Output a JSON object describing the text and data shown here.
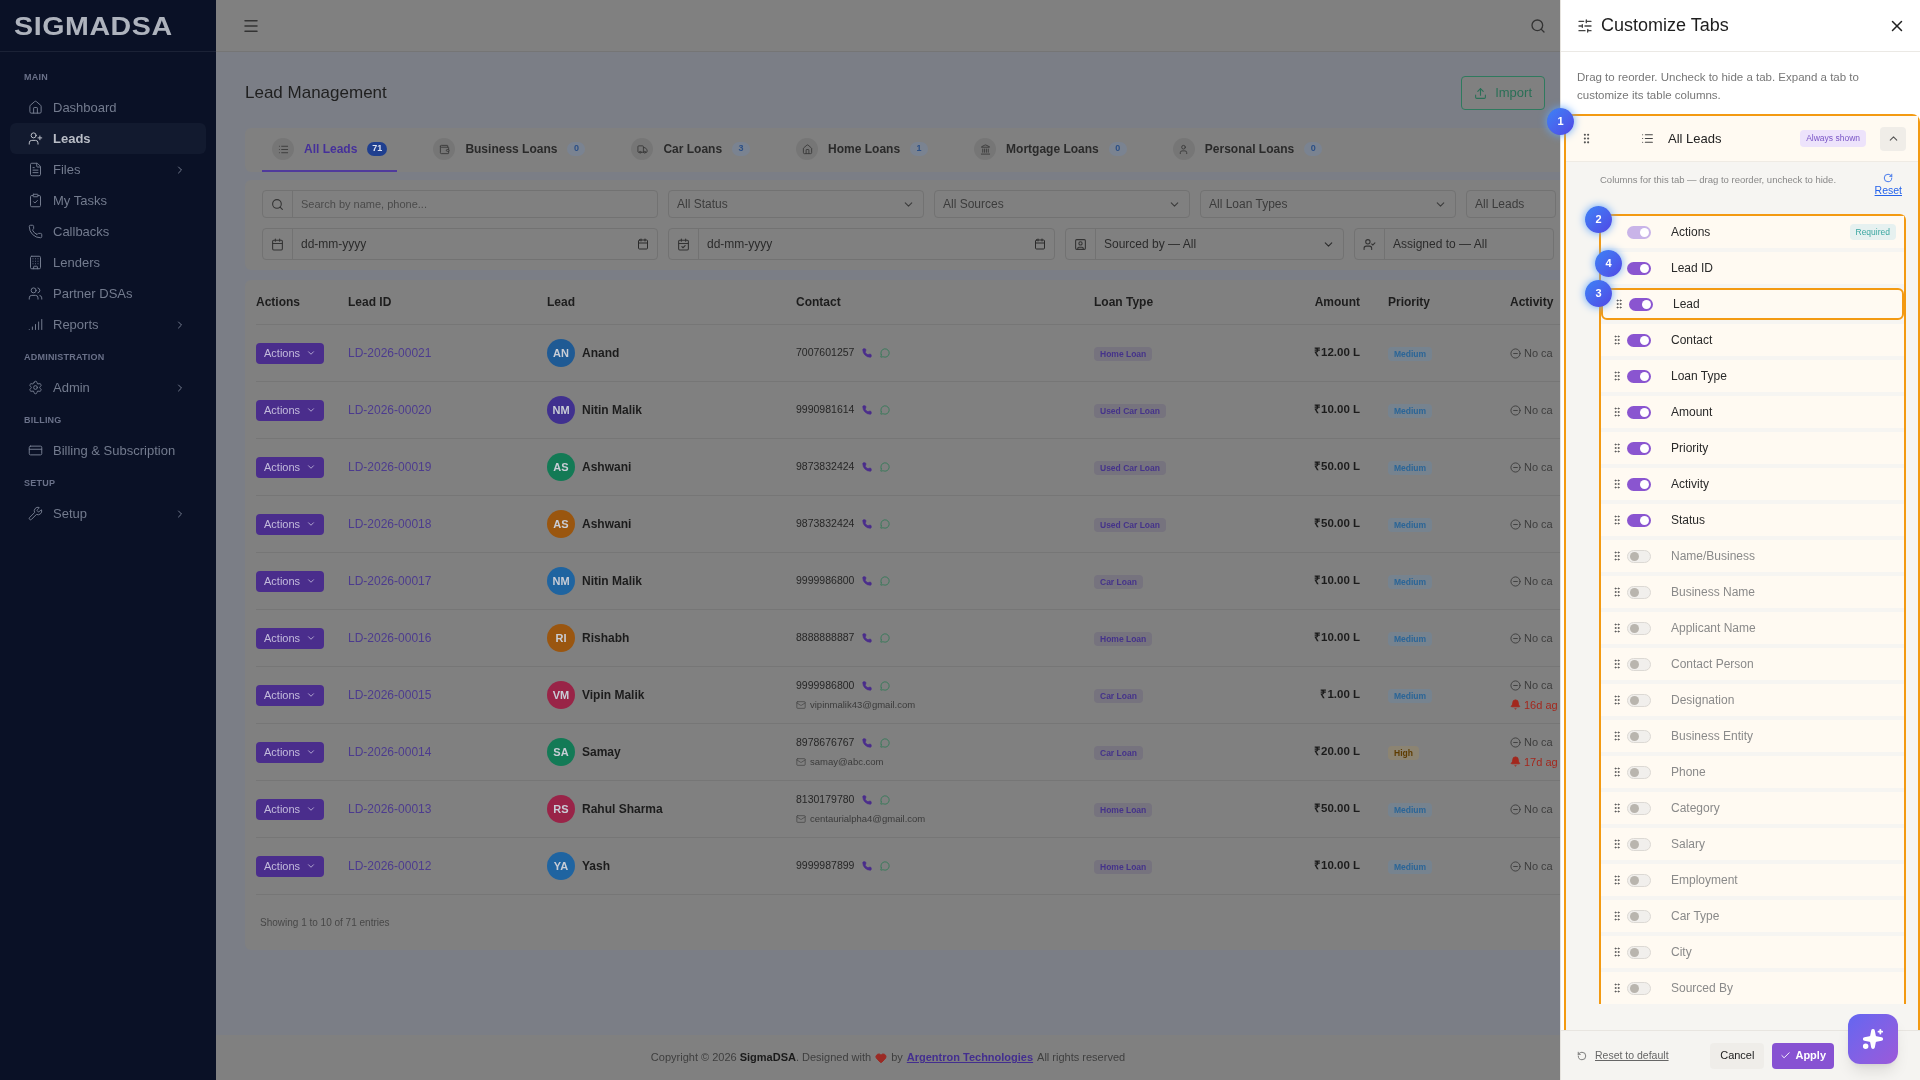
{
  "sidebar": {
    "logo": "SIGMADSA",
    "sections": [
      {
        "title": "MAIN",
        "items": [
          {
            "label": "Dashboard",
            "selected": false,
            "expandable": false
          },
          {
            "label": "Leads",
            "selected": true,
            "expandable": false
          },
          {
            "label": "Files",
            "selected": false,
            "expandable": true
          },
          {
            "label": "My Tasks",
            "selected": false,
            "expandable": false
          },
          {
            "label": "Callbacks",
            "selected": false,
            "expandable": false
          },
          {
            "label": "Lenders",
            "selected": false,
            "expandable": false
          },
          {
            "label": "Partner DSAs",
            "selected": false,
            "expandable": false
          },
          {
            "label": "Reports",
            "selected": false,
            "expandable": true
          }
        ]
      },
      {
        "title": "ADMINISTRATION",
        "items": [
          {
            "label": "Admin",
            "selected": false,
            "expandable": true
          }
        ]
      },
      {
        "title": "BILLING",
        "items": [
          {
            "label": "Billing & Subscription",
            "selected": false,
            "expandable": false
          }
        ]
      },
      {
        "title": "SETUP",
        "items": [
          {
            "label": "Setup",
            "selected": false,
            "expandable": true
          }
        ]
      }
    ]
  },
  "page": {
    "title": "Lead Management",
    "import_button": "Import"
  },
  "tabs": [
    {
      "label": "All Leads",
      "count": "71",
      "selected": true
    },
    {
      "label": "Business Loans",
      "count": "0",
      "selected": false
    },
    {
      "label": "Car Loans",
      "count": "3",
      "selected": false
    },
    {
      "label": "Home Loans",
      "count": "1",
      "selected": false
    },
    {
      "label": "Mortgage Loans",
      "count": "0",
      "selected": false
    },
    {
      "label": "Personal Loans",
      "count": "0",
      "selected": false
    }
  ],
  "filters": {
    "search": {
      "placeholder": "Search by name, phone..."
    },
    "selects": [
      "All Status",
      "All Sources",
      "All Loan Types",
      "All Leads"
    ],
    "date_from": {
      "placeholder": "dd-mm-yyyy"
    },
    "date_to": {
      "placeholder": "dd-mm-yyyy"
    },
    "sourced_by": "Sourced by — All",
    "assigned_to": "Assigned to — All"
  },
  "table": {
    "columns": [
      "Actions",
      "Lead ID",
      "Lead",
      "Contact",
      "Loan Type",
      "Amount",
      "Priority",
      "Activity"
    ],
    "rows": [
      {
        "action": "Actions",
        "lead_id": "LD-2026-00021",
        "initials": "AN",
        "name": "Anand",
        "color": "#1f5a94",
        "phone": "7007601257",
        "loan_type": "Home Loan",
        "amount": "₹12.00 L",
        "priority": {
          "label": "Medium",
          "kind": "medium"
        },
        "activity": "No ca"
      },
      {
        "action": "Actions",
        "lead_id": "LD-2026-00020",
        "initials": "NM",
        "name": "Nitin Malik",
        "color": "#40308f",
        "phone": "9990981614",
        "loan_type": "Used Car Loan",
        "amount": "₹10.00 L",
        "priority": {
          "label": "Medium",
          "kind": "medium"
        },
        "activity": "No ca"
      },
      {
        "action": "Actions",
        "lead_id": "LD-2026-00019",
        "initials": "AS",
        "name": "Ashwani",
        "color": "#137a55",
        "phone": "9873832424",
        "loan_type": "Used Car Loan",
        "amount": "₹50.00 L",
        "priority": {
          "label": "Medium",
          "kind": "medium"
        },
        "activity": "No ca"
      },
      {
        "action": "Actions",
        "lead_id": "LD-2026-00018",
        "initials": "AS",
        "name": "Ashwani",
        "color": "#9a560f",
        "phone": "9873832424",
        "loan_type": "Used Car Loan",
        "amount": "₹50.00 L",
        "priority": {
          "label": "Medium",
          "kind": "medium"
        },
        "activity": "No ca"
      },
      {
        "action": "Actions",
        "lead_id": "LD-2026-00017",
        "initials": "NM",
        "name": "Nitin Malik",
        "color": "#1f64a0",
        "phone": "9999986800",
        "loan_type": "Car Loan",
        "amount": "₹10.00 L",
        "priority": {
          "label": "Medium",
          "kind": "medium"
        },
        "activity": "No ca"
      },
      {
        "action": "Actions",
        "lead_id": "LD-2026-00016",
        "initials": "RI",
        "name": "Rishabh",
        "color": "#9a5610",
        "phone": "8888888887",
        "loan_type": "Home Loan",
        "amount": "₹10.00 L",
        "priority": {
          "label": "Medium",
          "kind": "medium"
        },
        "activity": "No ca"
      },
      {
        "action": "Actions",
        "lead_id": "LD-2026-00015",
        "initials": "VM",
        "name": "Vipin Malik",
        "color": "#992447",
        "phone": "9999986800",
        "email": "vipinmalik43@gmail.com",
        "loan_type": "Car Loan",
        "amount": "₹1.00 L",
        "priority": {
          "label": "Medium",
          "kind": "medium"
        },
        "activity": "No ca",
        "reminder": "16d ag"
      },
      {
        "action": "Actions",
        "lead_id": "LD-2026-00014",
        "initials": "SA",
        "name": "Samay",
        "color": "#137a56",
        "phone": "8978676767",
        "email": "samay@abc.com",
        "loan_type": "Car Loan",
        "amount": "₹20.00 L",
        "priority": {
          "label": "High",
          "kind": "high"
        },
        "activity": "No ca",
        "reminder": "17d ag"
      },
      {
        "action": "Actions",
        "lead_id": "LD-2026-00013",
        "initials": "RS",
        "name": "Rahul Sharma",
        "color": "#992448",
        "phone": "8130179780",
        "email": "centaurialpha4@gmail.com",
        "loan_type": "Home Loan",
        "amount": "₹50.00 L",
        "priority": {
          "label": "Medium",
          "kind": "medium"
        },
        "activity": "No ca"
      },
      {
        "action": "Actions",
        "lead_id": "LD-2026-00012",
        "initials": "YA",
        "name": "Yash",
        "color": "#1f64a1",
        "phone": "9999987899",
        "loan_type": "Home Loan",
        "amount": "₹10.00 L",
        "priority": {
          "label": "Medium",
          "kind": "medium"
        },
        "activity": "No ca"
      }
    ],
    "summary": "Showing 1 to 10 of 71 entries"
  },
  "footer": {
    "before": "Copyright © 2026 **SigmaDSA**. Designed with",
    "by": "by",
    "link": "Argentron Technologies",
    "after": "All rights reserved"
  },
  "panel": {
    "title": "Customize Tabs",
    "description": "Drag to reorder. Uncheck to hide a tab. Expand a tab to customize its table columns.",
    "tab": {
      "label": "All Leads",
      "badge": "Always shown",
      "expanded": true
    },
    "columns_note": "Columns for this tab — drag to reorder, uncheck to hide.",
    "reset": "Reset",
    "columns": [
      {
        "label": "Actions",
        "on": true,
        "disabled": true,
        "badge": "Required",
        "highlighted": false
      },
      {
        "label": "Lead ID",
        "on": true,
        "disabled": false,
        "highlighted": false
      },
      {
        "label": "Lead",
        "on": true,
        "disabled": false,
        "highlighted": true
      },
      {
        "label": "Contact",
        "on": true,
        "disabled": false,
        "highlighted": false
      },
      {
        "label": "Loan Type",
        "on": true,
        "disabled": false,
        "highlighted": false
      },
      {
        "label": "Amount",
        "on": true,
        "disabled": false,
        "highlighted": false
      },
      {
        "label": "Priority",
        "on": true,
        "disabled": false,
        "highlighted": false
      },
      {
        "label": "Activity",
        "on": true,
        "disabled": false,
        "highlighted": false
      },
      {
        "label": "Status",
        "on": true,
        "disabled": false,
        "highlighted": false
      },
      {
        "label": "Name/Business",
        "on": false,
        "disabled": false,
        "highlighted": false
      },
      {
        "label": "Business Name",
        "on": false,
        "disabled": false,
        "highlighted": false
      },
      {
        "label": "Applicant Name",
        "on": false,
        "disabled": false,
        "highlighted": false
      },
      {
        "label": "Contact Person",
        "on": false,
        "disabled": false,
        "highlighted": false
      },
      {
        "label": "Designation",
        "on": false,
        "disabled": false,
        "highlighted": false
      },
      {
        "label": "Business Entity",
        "on": false,
        "disabled": false,
        "highlighted": false
      },
      {
        "label": "Phone",
        "on": false,
        "disabled": false,
        "highlighted": false
      },
      {
        "label": "Category",
        "on": false,
        "disabled": false,
        "highlighted": false
      },
      {
        "label": "Salary",
        "on": false,
        "disabled": false,
        "highlighted": false
      },
      {
        "label": "Employment",
        "on": false,
        "disabled": false,
        "highlighted": false
      },
      {
        "label": "Car Type",
        "on": false,
        "disabled": false,
        "highlighted": false
      },
      {
        "label": "City",
        "on": false,
        "disabled": false,
        "highlighted": false
      },
      {
        "label": "Sourced By",
        "on": false,
        "disabled": false,
        "highlighted": false
      }
    ],
    "reset_default": "Reset to default",
    "cancel": "Cancel",
    "apply": "Apply",
    "tour_steps": [
      "1",
      "2",
      "4",
      "3"
    ]
  }
}
